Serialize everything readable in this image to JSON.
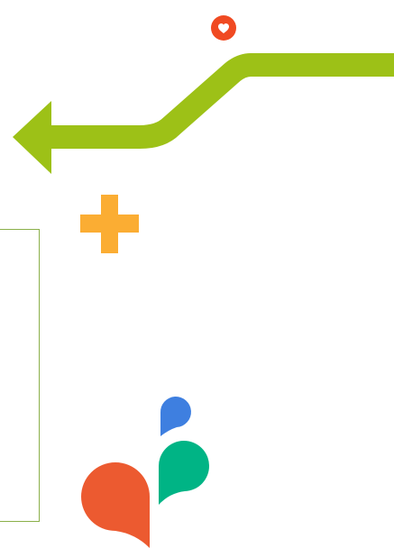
{
  "colors": {
    "background": "#ffffff",
    "arrow": "#9dc117",
    "heart_badge": "#f04a22",
    "heart": "#ffffff",
    "plus": "#fbad33",
    "outline_box": "#8bb04a",
    "drop_blue": "#3e7fe0",
    "drop_green": "#00b485",
    "drop_orange": "#ec5a30"
  },
  "icons": [
    "heart-badge-icon",
    "arrow-left-icon",
    "plus-icon",
    "drops-logo-icon"
  ]
}
